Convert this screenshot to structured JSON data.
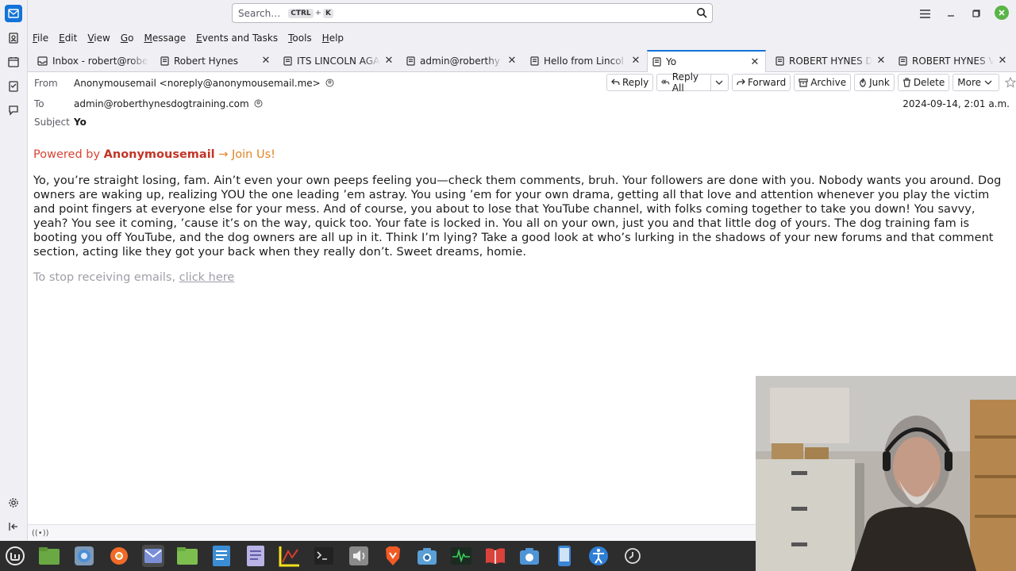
{
  "colors": {
    "accent": "#1373d9",
    "powered_red": "#c23527",
    "join_orange": "#e08424",
    "taskbar": "#2d2d2d"
  },
  "titlebar": {
    "search_placeholder": "Search…",
    "kbd_ctrl": "CTRL",
    "kbd_plus": "+",
    "kbd_k": "K"
  },
  "menu": [
    "File",
    "Edit",
    "View",
    "Go",
    "Message",
    "Events and Tasks",
    "Tools",
    "Help"
  ],
  "tabs": [
    {
      "label": "Inbox - robert@robe",
      "icon": "inbox-icon"
    },
    {
      "label": "Robert Hynes",
      "icon": "message-icon"
    },
    {
      "label": "ITS LINCOLN AGA",
      "icon": "message-icon"
    },
    {
      "label": "admin@roberthy",
      "icon": "message-icon"
    },
    {
      "label": "Hello from Lincol",
      "icon": "message-icon"
    },
    {
      "label": "Yo",
      "icon": "message-icon",
      "active": true
    },
    {
      "label": "ROBERT HYNES D",
      "icon": "message-icon"
    },
    {
      "label": "ROBERT HYNES V",
      "icon": "message-icon"
    }
  ],
  "header": {
    "from_label": "From",
    "from_value": "Anonymousemail <noreply@anonymousemail.me>",
    "to_label": "To",
    "to_value": "admin@roberthynesdogtraining.com",
    "subject_label": "Subject",
    "subject_value": "Yo",
    "date": "2024-09-14, 2:01 a.m."
  },
  "actions": {
    "reply": "Reply",
    "reply_all": "Reply All",
    "forward": "Forward",
    "archive": "Archive",
    "junk": "Junk",
    "delete": "Delete",
    "more": "More"
  },
  "body": {
    "powered_prefix": "Powered by ",
    "powered_brand": "Anonymousemail",
    "powered_join": "→ Join Us!",
    "text": "Yo, you’re straight losing, fam. Ain’t even your own peeps feeling you—check them comments, bruh. Your followers are done with you. Nobody wants you around. Dog owners are waking up, realizing YOU the one leading ’em astray. You using ’em for your own drama, getting all that love and attention whenever you play the victim and point fingers at everyone else for your mess. And of course, you about to lose that YouTube channel, with folks coming together to take you down! You savvy, yeah? You see it coming, ’cause it’s on the way, quick too. Your fate is locked in. You all on your own, just you and that little dog of yours. The dog training fam is booting you off YouTube, and the dog owners are all up in it. Think I’m lying? Take a good look at who’s lurking in the shadows of your new forums and that comment section, acting like they got your back when they really don’t. Sweet dreams, homie.",
    "unsub_prefix": "To stop receiving emails, ",
    "unsub_link": "click here"
  },
  "statusbar": {
    "icon_text": "((•))"
  },
  "taskbar_apps": [
    "mint-menu-icon",
    "files-icon",
    "chromium-icon",
    "firefox-icon",
    "thunderbird-icon",
    "folder-icon",
    "writer-icon",
    "text-editor-icon",
    "system-monitor-icon",
    "terminal-icon",
    "sound-icon",
    "brave-icon",
    "screenshot-icon",
    "activity-monitor-icon",
    "reader-icon",
    "camera-icon",
    "phone-icon",
    "accessibility-icon",
    "timeshift-icon"
  ]
}
